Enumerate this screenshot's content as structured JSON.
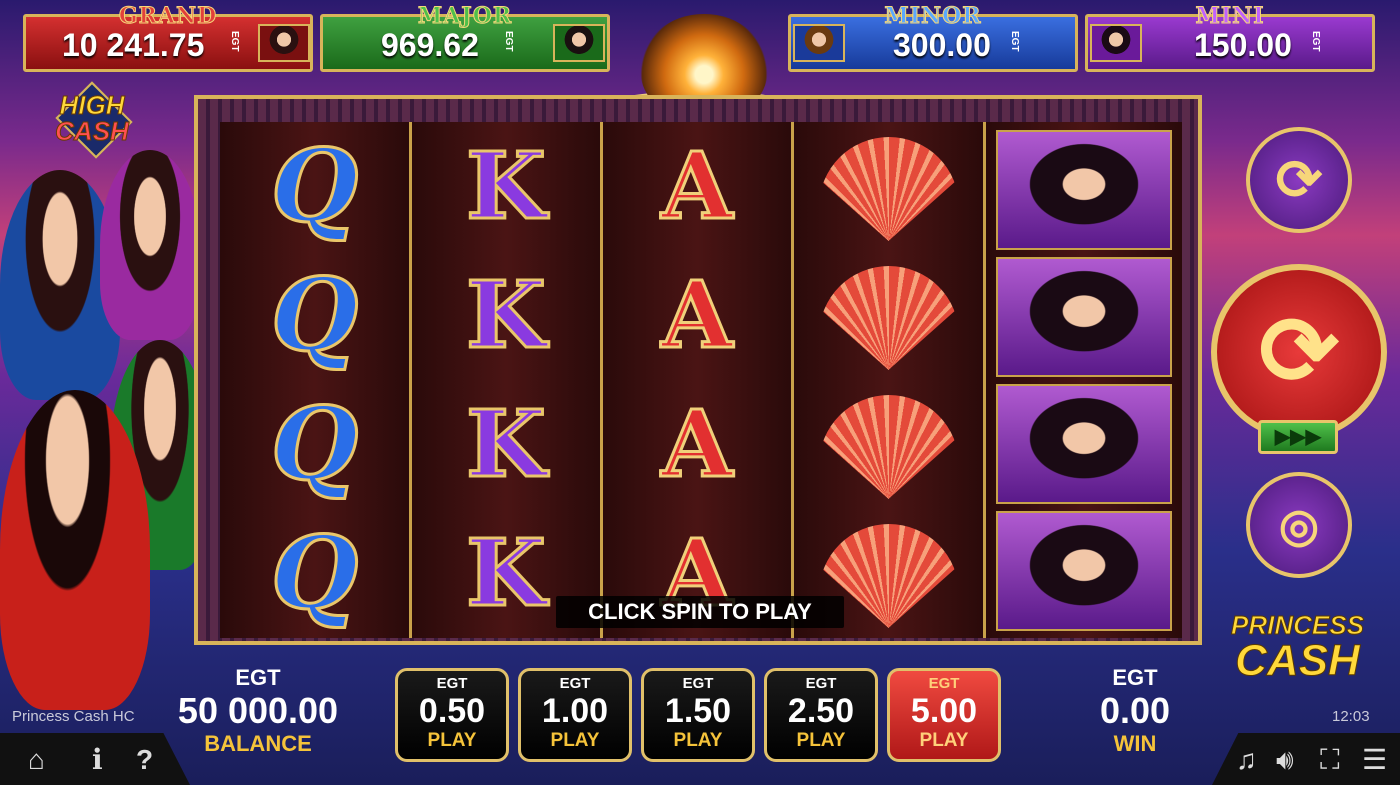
{
  "jackpots": {
    "grand": {
      "label": "GRAND",
      "value": "10 241.75",
      "currency": "EGT"
    },
    "major": {
      "label": "MAJOR",
      "value": "969.62",
      "currency": "EGT"
    },
    "minor": {
      "label": "MINOR",
      "value": "300.00",
      "currency": "EGT"
    },
    "mini": {
      "label": "MINI",
      "value": "150.00",
      "currency": "EGT"
    }
  },
  "logos": {
    "high_cash_line1": "HIGH",
    "high_cash_line2": "CASH",
    "princess_cash_line1": "PRINCESS",
    "princess_cash_line2": "CASH"
  },
  "reels": [
    [
      "Q",
      "Q",
      "Q",
      "Q"
    ],
    [
      "K",
      "K",
      "K",
      "K"
    ],
    [
      "A",
      "A",
      "A",
      "A"
    ],
    [
      "fan",
      "fan",
      "fan",
      "fan"
    ],
    [
      "princess",
      "princess",
      "princess",
      "princess"
    ]
  ],
  "message": "CLICK SPIN TO PLAY",
  "balance": {
    "currency": "EGT",
    "value": "50 000.00",
    "label": "BALANCE"
  },
  "win": {
    "currency": "EGT",
    "value": "0.00",
    "label": "WIN"
  },
  "bets": [
    {
      "currency": "EGT",
      "value": "0.50",
      "label": "PLAY",
      "active": false
    },
    {
      "currency": "EGT",
      "value": "1.00",
      "label": "PLAY",
      "active": false
    },
    {
      "currency": "EGT",
      "value": "1.50",
      "label": "PLAY",
      "active": false
    },
    {
      "currency": "EGT",
      "value": "2.50",
      "label": "PLAY",
      "active": false
    },
    {
      "currency": "EGT",
      "value": "5.00",
      "label": "PLAY",
      "active": true
    }
  ],
  "game_name": "Princess Cash HC",
  "clock": "12:03",
  "icons": {
    "home": "home-icon",
    "info": "info-icon",
    "help": "help-icon",
    "music": "music-icon",
    "sound": "volume-icon",
    "fullscreen": "fullscreen-icon",
    "menu": "menu-icon",
    "autoplay": "autoplay-icon",
    "spin": "spin-icon",
    "turbo": "turbo-icon",
    "coins": "coins-icon"
  },
  "turbo_glyph": "▶▶▶",
  "colors": {
    "gold": "#d8b45a",
    "bet_active": "#e83a3a",
    "label_yellow": "#f5c33a"
  }
}
